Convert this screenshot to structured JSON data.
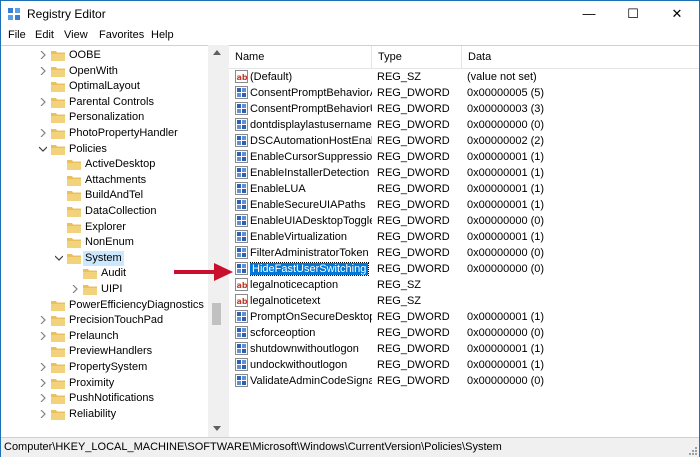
{
  "window": {
    "title": "Registry Editor"
  },
  "window_controls": {
    "minimize": "—",
    "maximize": "☐",
    "close": "✕"
  },
  "menu": [
    "File",
    "Edit",
    "View",
    "Favorites",
    "Help"
  ],
  "tree": [
    {
      "label": "OOBE",
      "level": 0,
      "expander": "right"
    },
    {
      "label": "OpenWith",
      "level": 0,
      "expander": "right"
    },
    {
      "label": "OptimalLayout",
      "level": 0,
      "expander": "none"
    },
    {
      "label": "Parental Controls",
      "level": 0,
      "expander": "right"
    },
    {
      "label": "Personalization",
      "level": 0,
      "expander": "none"
    },
    {
      "label": "PhotoPropertyHandler",
      "level": 0,
      "expander": "right"
    },
    {
      "label": "Policies",
      "level": 0,
      "expander": "down"
    },
    {
      "label": "ActiveDesktop",
      "level": 1,
      "expander": "none"
    },
    {
      "label": "Attachments",
      "level": 1,
      "expander": "none"
    },
    {
      "label": "BuildAndTel",
      "level": 1,
      "expander": "none"
    },
    {
      "label": "DataCollection",
      "level": 1,
      "expander": "none"
    },
    {
      "label": "Explorer",
      "level": 1,
      "expander": "none"
    },
    {
      "label": "NonEnum",
      "level": 1,
      "expander": "none"
    },
    {
      "label": "System",
      "level": 1,
      "expander": "down",
      "selected": true
    },
    {
      "label": "Audit",
      "level": 2,
      "expander": "none"
    },
    {
      "label": "UIPI",
      "level": 2,
      "expander": "right"
    },
    {
      "label": "PowerEfficiencyDiagnostics",
      "level": 0,
      "expander": "none"
    },
    {
      "label": "PrecisionTouchPad",
      "level": 0,
      "expander": "right"
    },
    {
      "label": "Prelaunch",
      "level": 0,
      "expander": "right"
    },
    {
      "label": "PreviewHandlers",
      "level": 0,
      "expander": "none"
    },
    {
      "label": "PropertySystem",
      "level": 0,
      "expander": "right"
    },
    {
      "label": "Proximity",
      "level": 0,
      "expander": "right"
    },
    {
      "label": "PushNotifications",
      "level": 0,
      "expander": "right"
    },
    {
      "label": "Reliability",
      "level": 0,
      "expander": "right"
    }
  ],
  "list": {
    "columns": [
      "Name",
      "Type",
      "Data"
    ],
    "rows": [
      {
        "icon": "string-value-icon",
        "name": "(Default)",
        "type": "REG_SZ",
        "data": "(value not set)"
      },
      {
        "icon": "dword-value-icon",
        "name": "ConsentPromptBehaviorAdmin",
        "type": "REG_DWORD",
        "data": "0x00000005 (5)"
      },
      {
        "icon": "dword-value-icon",
        "name": "ConsentPromptBehaviorUser",
        "type": "REG_DWORD",
        "data": "0x00000003 (3)"
      },
      {
        "icon": "dword-value-icon",
        "name": "dontdisplaylastusername",
        "type": "REG_DWORD",
        "data": "0x00000000 (0)"
      },
      {
        "icon": "dword-value-icon",
        "name": "DSCAutomationHostEnabled",
        "type": "REG_DWORD",
        "data": "0x00000002 (2)"
      },
      {
        "icon": "dword-value-icon",
        "name": "EnableCursorSuppression",
        "type": "REG_DWORD",
        "data": "0x00000001 (1)"
      },
      {
        "icon": "dword-value-icon",
        "name": "EnableInstallerDetection",
        "type": "REG_DWORD",
        "data": "0x00000001 (1)"
      },
      {
        "icon": "dword-value-icon",
        "name": "EnableLUA",
        "type": "REG_DWORD",
        "data": "0x00000001 (1)"
      },
      {
        "icon": "dword-value-icon",
        "name": "EnableSecureUIAPaths",
        "type": "REG_DWORD",
        "data": "0x00000001 (1)"
      },
      {
        "icon": "dword-value-icon",
        "name": "EnableUIADesktopToggle",
        "type": "REG_DWORD",
        "data": "0x00000000 (0)"
      },
      {
        "icon": "dword-value-icon",
        "name": "EnableVirtualization",
        "type": "REG_DWORD",
        "data": "0x00000001 (1)"
      },
      {
        "icon": "dword-value-icon",
        "name": "FilterAdministratorToken",
        "type": "REG_DWORD",
        "data": "0x00000000 (0)"
      },
      {
        "icon": "dword-value-icon",
        "name": "HideFastUserSwitching",
        "type": "REG_DWORD",
        "data": "0x00000000 (0)",
        "selected": true
      },
      {
        "icon": "string-value-icon",
        "name": "legalnoticecaption",
        "type": "REG_SZ",
        "data": ""
      },
      {
        "icon": "string-value-icon",
        "name": "legalnoticetext",
        "type": "REG_SZ",
        "data": ""
      },
      {
        "icon": "dword-value-icon",
        "name": "PromptOnSecureDesktop",
        "type": "REG_DWORD",
        "data": "0x00000001 (1)"
      },
      {
        "icon": "dword-value-icon",
        "name": "scforceoption",
        "type": "REG_DWORD",
        "data": "0x00000000 (0)"
      },
      {
        "icon": "dword-value-icon",
        "name": "shutdownwithoutlogon",
        "type": "REG_DWORD",
        "data": "0x00000001 (1)"
      },
      {
        "icon": "dword-value-icon",
        "name": "undockwithoutlogon",
        "type": "REG_DWORD",
        "data": "0x00000001 (1)"
      },
      {
        "icon": "dword-value-icon",
        "name": "ValidateAdminCodeSignatures",
        "type": "REG_DWORD",
        "data": "0x00000000 (0)"
      }
    ]
  },
  "status": {
    "path": "Computer\\HKEY_LOCAL_MACHINE\\SOFTWARE\\Microsoft\\Windows\\CurrentVersion\\Policies\\System"
  },
  "colors": {
    "selection": "#0078d7",
    "tree_selection": "#cce8ff",
    "arrow": "#c8102e",
    "folder": "#e8c060"
  }
}
